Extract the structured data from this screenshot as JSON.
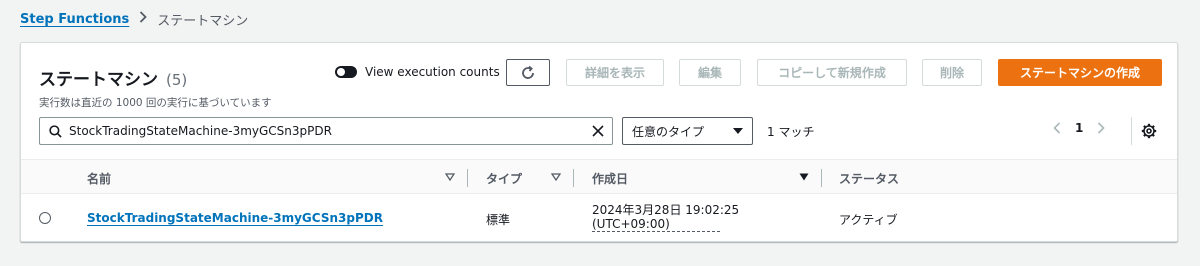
{
  "breadcrumb": {
    "parent": "Step Functions",
    "current": "ステートマシン"
  },
  "header": {
    "title": "ステートマシン",
    "count": "(5)",
    "subtitle": "実行数は直近の 1000 回の実行に基づいています"
  },
  "toggle": {
    "label": "View execution counts",
    "on": false
  },
  "toolbar": {
    "details_label": "詳細を表示",
    "edit_label": "編集",
    "copy_label": "コピーして新規作成",
    "delete_label": "削除",
    "create_label": "ステートマシンの作成"
  },
  "filter": {
    "search_value": "StockTradingStateMachine-3myGCSn3pPDR",
    "type_selected": "任意のタイプ",
    "match_text": "1 マッチ"
  },
  "pagination": {
    "current_page": "1"
  },
  "table": {
    "columns": [
      "名前",
      "タイプ",
      "作成日",
      "ステータス"
    ],
    "rows": [
      {
        "name": "StockTradingStateMachine-3myGCSn3pPDR",
        "type": "標準",
        "date_line1": "2024年3月28日 19:02:25",
        "date_line2": "(UTC+09:00)",
        "status": "アクティブ"
      }
    ]
  },
  "colors": {
    "link": "#0073bb",
    "primary": "#ec7211",
    "text": "#16191f"
  }
}
